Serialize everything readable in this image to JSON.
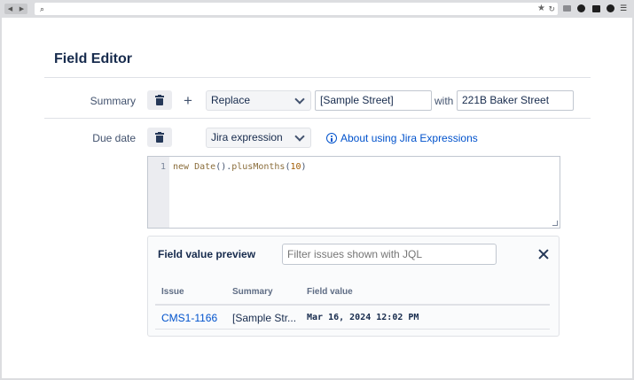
{
  "editor": {
    "title": "Field Editor",
    "summary_row": {
      "label": "Summary",
      "add_symbol": "+",
      "operation": "Replace",
      "find_value": "[Sample Street]",
      "with_label": "with",
      "replace_value": "221B Baker Street"
    },
    "duedate_row": {
      "label": "Due date",
      "mode": "Jira expression",
      "help_link": "About using Jira Expressions",
      "line_number": "1",
      "code": {
        "kw": "new",
        "fn1": "Date",
        "punct1": "().",
        "fn2": "plusMonths",
        "punct2": "(",
        "num": "10",
        "punct3": ")"
      }
    }
  },
  "preview": {
    "title": "Field value preview",
    "jql_placeholder": "Filter issues shown with JQL",
    "columns": [
      "Issue",
      "Summary",
      "Field value"
    ],
    "rows": [
      {
        "issue": "CMS1-1166",
        "summary": "[Sample Str...",
        "field_value": "Mar 16, 2024 12:02 PM"
      }
    ]
  },
  "colors": {
    "link": "#0052cc",
    "text": "#172b4d",
    "border": "#dfe1e6"
  },
  "icons": [
    "search-icon",
    "star-icon",
    "reload-icon",
    "trash-icon",
    "plus-icon",
    "chevron-down-icon",
    "info-icon",
    "close-icon"
  ]
}
